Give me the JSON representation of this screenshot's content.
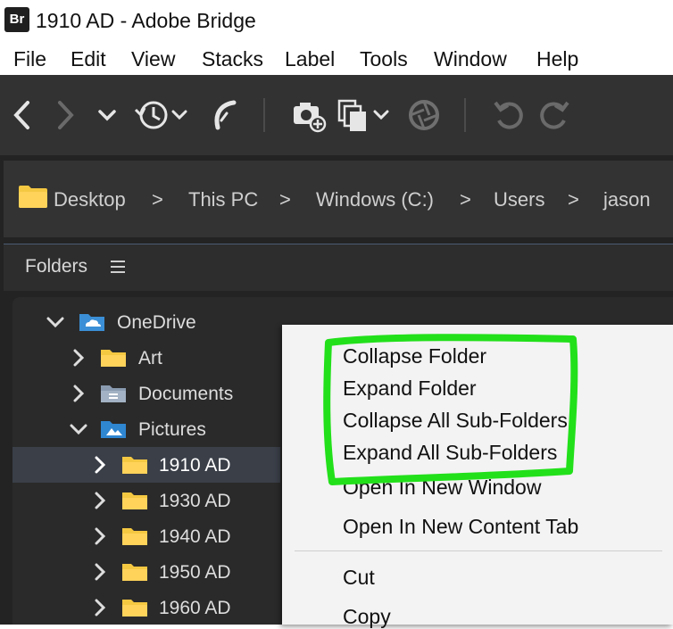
{
  "window": {
    "app_icon_text": "Br",
    "title": "1910 AD - Adobe Bridge"
  },
  "menubar": {
    "items": [
      "File",
      "Edit",
      "View",
      "Stacks",
      "Label",
      "Tools",
      "Window",
      "Help"
    ]
  },
  "toolbar": {
    "icons": [
      "back-arrow-icon",
      "forward-arrow-icon",
      "recent-dropdown-icon",
      "history-clock-icon",
      "return-to-app-icon",
      "get-photos-camera-icon",
      "output-copies-icon",
      "camera-raw-aperture-icon",
      "rotate-left-icon",
      "rotate-right-icon"
    ]
  },
  "path_bar": {
    "crumbs": [
      "Desktop",
      "This PC",
      "Windows (C:)",
      "Users",
      "jason"
    ],
    "separator": ">"
  },
  "panel": {
    "title": "Folders"
  },
  "tree": [
    {
      "label": "OneDrive",
      "expanded": true,
      "icon": "onedrive-folder-icon"
    },
    {
      "label": "Art",
      "expanded": false,
      "icon": "folder-icon"
    },
    {
      "label": "Documents",
      "expanded": false,
      "icon": "documents-folder-icon"
    },
    {
      "label": "Pictures",
      "expanded": true,
      "icon": "pictures-folder-icon"
    },
    {
      "label": "1910 AD",
      "expanded": false,
      "selected": true,
      "icon": "folder-icon"
    },
    {
      "label": "1930 AD",
      "expanded": false,
      "icon": "folder-icon"
    },
    {
      "label": "1940 AD",
      "expanded": false,
      "icon": "folder-icon"
    },
    {
      "label": "1950 AD",
      "expanded": false,
      "icon": "folder-icon"
    },
    {
      "label": "1960 AD",
      "expanded": false,
      "icon": "folder-icon"
    }
  ],
  "context_menu": {
    "items": [
      "Collapse Folder",
      "Expand Folder",
      "Collapse All Sub-Folders",
      "Expand All Sub-Folders",
      "Open In New Window",
      "Open In New Content Tab",
      "Cut",
      "Copy"
    ]
  },
  "annotation": {
    "color": "#22e01a"
  },
  "colors": {
    "folder": "#f5c842",
    "toolbar_bg": "#323232",
    "panel_bg": "#2a2a2a",
    "selection": "#3a3f48"
  }
}
